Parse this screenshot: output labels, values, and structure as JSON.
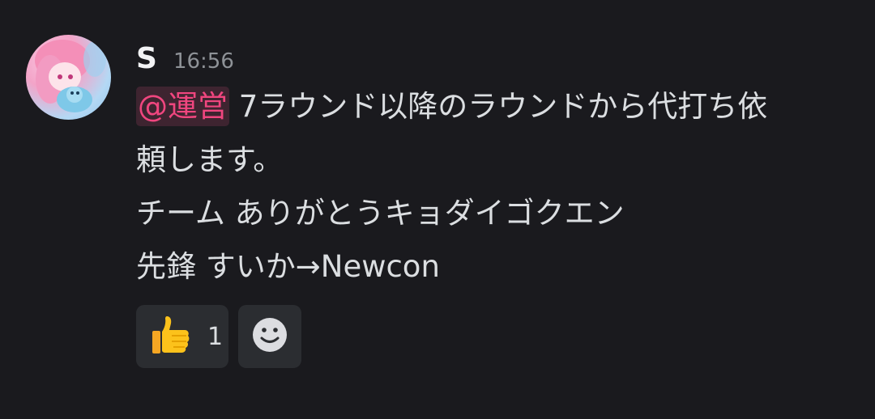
{
  "message": {
    "author": "S",
    "timestamp": "16:56",
    "mention": "@運営",
    "lines": [
      "7ラウンド以降のラウンドから代打ち依",
      "頼します。",
      "チーム ありがとうキョダイゴクエン",
      "先鋒 すいか→Newcon"
    ]
  },
  "reactions": [
    {
      "icon": "thumbs-up-icon",
      "count": "1"
    },
    {
      "icon": "add-reaction-smiley-icon"
    }
  ],
  "colors": {
    "background": "#1a1a1e",
    "text": "#dbdee1",
    "mention": "#f0467f",
    "mention_bg": "#3e2430",
    "timestamp": "#8e9297",
    "reaction_bg": "#2b2d31"
  }
}
